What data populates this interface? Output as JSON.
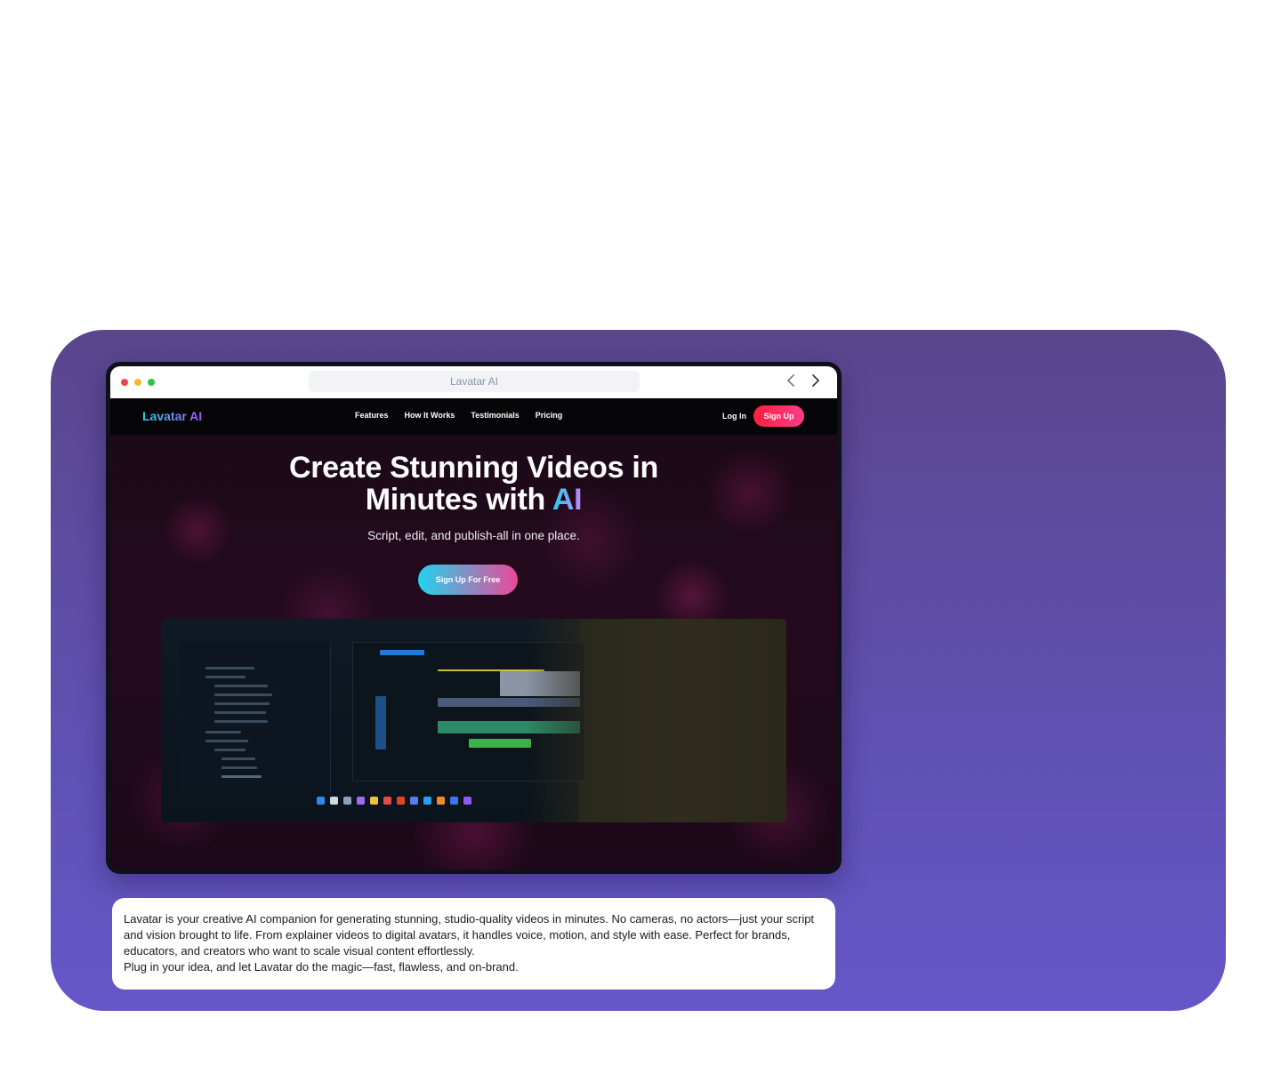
{
  "browser": {
    "url_text": "Lavatar AI"
  },
  "site": {
    "logo": "Lavatar AI",
    "nav": [
      {
        "label": "Features"
      },
      {
        "label": "How It Works"
      },
      {
        "label": "Testimonials"
      },
      {
        "label": "Pricing"
      }
    ],
    "login_label": "Log In",
    "signup_label": "Sign Up",
    "hero": {
      "title_line1": "Create Stunning Videos in",
      "title_line2_prefix": "Minutes with ",
      "title_highlight": "AI",
      "subtitle": "Script, edit, and publish-all in one place.",
      "cta_label": "Sign Up For Free"
    }
  },
  "description": {
    "paragraph1": "Lavatar is your creative AI companion for generating stunning, studio-quality videos in minutes. No cameras, no actors—just your script and vision brought to life. From explainer videos to digital avatars, it handles voice, motion, and style with ease. Perfect for brands, educators, and creators who want to scale visual content effortlessly.",
    "paragraph2": "Plug in your idea, and let Lavatar do the magic—fast, flawless, and on-brand."
  },
  "colors": {
    "card_background": "#5f50b0",
    "signup_button": "#ff1f3d",
    "cta_gradient_start": "#22d3ee",
    "cta_gradient_end": "#ec4899"
  }
}
